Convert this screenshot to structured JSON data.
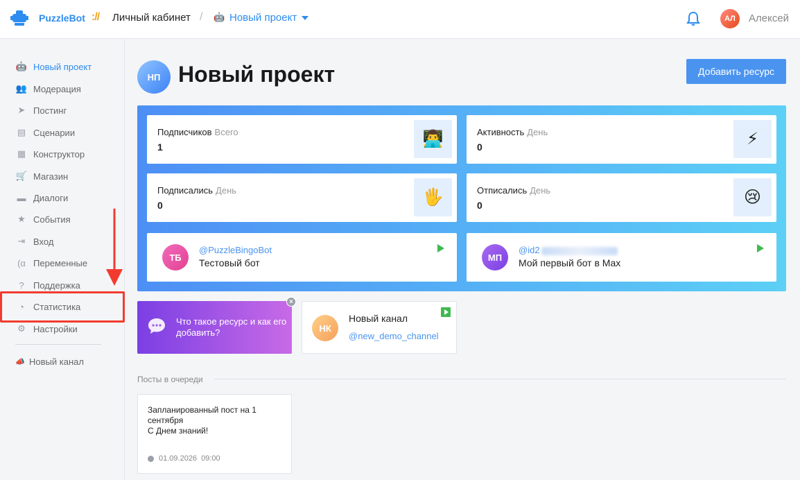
{
  "header": {
    "brand": "PuzzleBot",
    "brand_separator": "://",
    "cabinet": "Личный кабинет",
    "slash": "/",
    "project_icon": "🤖",
    "project": "Новый проект",
    "user_initials": "АЛ",
    "user_name": "Алексей"
  },
  "sidebar": {
    "items": [
      {
        "icon": "robot-icon",
        "glyph": "🤖",
        "label": "Новый проект"
      },
      {
        "icon": "users-icon",
        "glyph": "👥",
        "label": "Модерация"
      },
      {
        "icon": "paper-plane-icon",
        "glyph": "➤",
        "label": "Постинг"
      },
      {
        "icon": "scenarios-icon",
        "glyph": "▤",
        "label": "Сценарии"
      },
      {
        "icon": "grid-icon",
        "glyph": "▦",
        "label": "Конструктор"
      },
      {
        "icon": "cart-icon",
        "glyph": "🛒",
        "label": "Магазин"
      },
      {
        "icon": "chat-icon",
        "glyph": "▬",
        "label": "Диалоги"
      },
      {
        "icon": "star-icon",
        "glyph": "★",
        "label": "События"
      },
      {
        "icon": "sign-in-icon",
        "glyph": "⇥",
        "label": "Вход"
      },
      {
        "icon": "variable-icon",
        "glyph": "(α",
        "label": "Переменные"
      },
      {
        "icon": "question-icon",
        "glyph": "?",
        "label": "Поддержка"
      },
      {
        "icon": "pie-chart-icon",
        "glyph": "◔",
        "label": "Статистика"
      },
      {
        "icon": "gear-icon",
        "glyph": "⚙",
        "label": "Настройки"
      }
    ],
    "channel": {
      "icon": "megaphone-icon",
      "glyph": "📣",
      "label": "Новый канал"
    }
  },
  "main": {
    "avatar": "НП",
    "title": "Новый проект",
    "add_button": "Добавить ресурс",
    "stats": [
      {
        "label": "Подписчиков",
        "sub": "Всего",
        "value": "1",
        "emoji": "👨‍💻"
      },
      {
        "label": "Активность",
        "sub": "День",
        "value": "0",
        "emoji": "⚡"
      },
      {
        "label": "Подписались",
        "sub": "День",
        "value": "0",
        "emoji": "🖐"
      },
      {
        "label": "Отписались",
        "sub": "День",
        "value": "0",
        "emoji": "😢"
      }
    ],
    "bots": [
      {
        "initials": "ТБ",
        "handle": "@PuzzleBingoBot",
        "name": "Тестовый бот",
        "color_a": "#f06bbd",
        "color_b": "#e4418f"
      },
      {
        "initials": "МП",
        "handle": "@id2",
        "name": "Мой первый бот в Max",
        "color_a": "#a86bf0",
        "color_b": "#7b3fe4"
      }
    ],
    "promo": "Что такое ресурс и как его добавить?",
    "promo_close": "×",
    "channel": {
      "initials": "НК",
      "name": "Новый канал",
      "handle": "@new_demo_channel"
    },
    "queue_title": "Посты в очереди",
    "post": {
      "text_line1": "Запланированный пост на 1 сентября",
      "text_line2": "С Днем знаний!",
      "date": "01.09.2026",
      "time": "09:00"
    }
  }
}
